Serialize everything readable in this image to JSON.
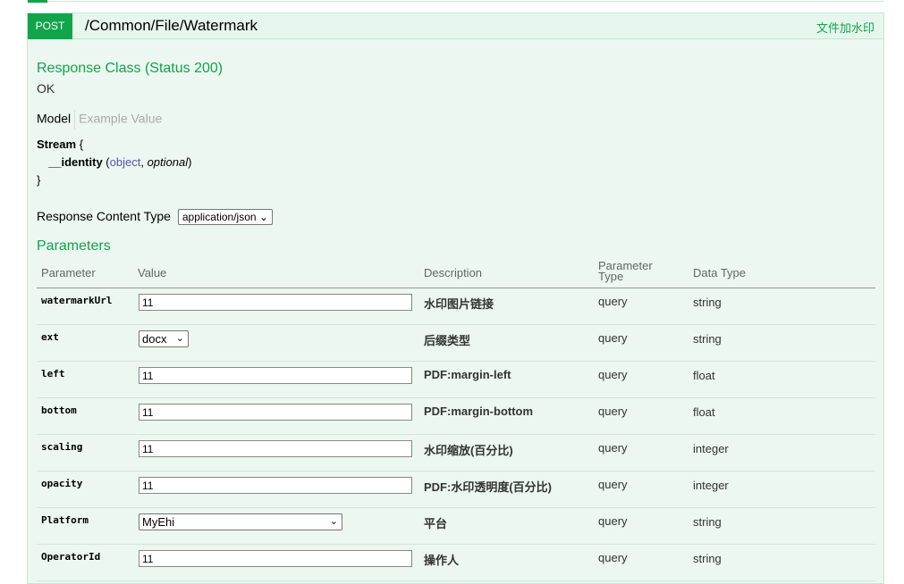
{
  "endpoint": {
    "method": "POST",
    "path": "/Common/File/Watermark",
    "summary": "文件加水印"
  },
  "response": {
    "title": "Response Class (Status 200)",
    "status_text": "OK",
    "tabs": {
      "model": "Model",
      "example": "Example Value"
    },
    "model": {
      "name": "Stream",
      "open_brace": "{",
      "close_brace": "}",
      "field_name": "__identity",
      "field_type": "object",
      "field_optional": "optional"
    },
    "content_type_label": "Response Content Type",
    "content_type_value": "application/json"
  },
  "parameters": {
    "title": "Parameters",
    "headers": {
      "parameter": "Parameter",
      "value": "Value",
      "description": "Description",
      "param_type_line1": "Parameter",
      "param_type_line2": "Type",
      "data_type": "Data Type"
    },
    "rows": [
      {
        "name": "watermarkUrl",
        "value": "11",
        "description": "水印图片链接",
        "param_type": "query",
        "data_type": "string"
      },
      {
        "name": "ext",
        "value": "docx",
        "description": "后缀类型",
        "param_type": "query",
        "data_type": "string"
      },
      {
        "name": "left",
        "value": "11",
        "description": "PDF:margin-left",
        "param_type": "query",
        "data_type": "float"
      },
      {
        "name": "bottom",
        "value": "11",
        "description": "PDF:margin-bottom",
        "param_type": "query",
        "data_type": "float"
      },
      {
        "name": "scaling",
        "value": "11",
        "description": "水印缩放(百分比)",
        "param_type": "query",
        "data_type": "integer"
      },
      {
        "name": "opacity",
        "value": "11",
        "description": "PDF:水印透明度(百分比)",
        "param_type": "query",
        "data_type": "integer"
      },
      {
        "name": "Platform",
        "value": "MyEhi",
        "description": "平台",
        "param_type": "query",
        "data_type": "string"
      },
      {
        "name": "OperatorId",
        "value": "11",
        "description": "操作人",
        "param_type": "query",
        "data_type": "string"
      }
    ]
  },
  "colors": {
    "accent": "#10a54a",
    "panel_bg": "#ebf7f0",
    "panel_border": "#c3e8d1"
  }
}
